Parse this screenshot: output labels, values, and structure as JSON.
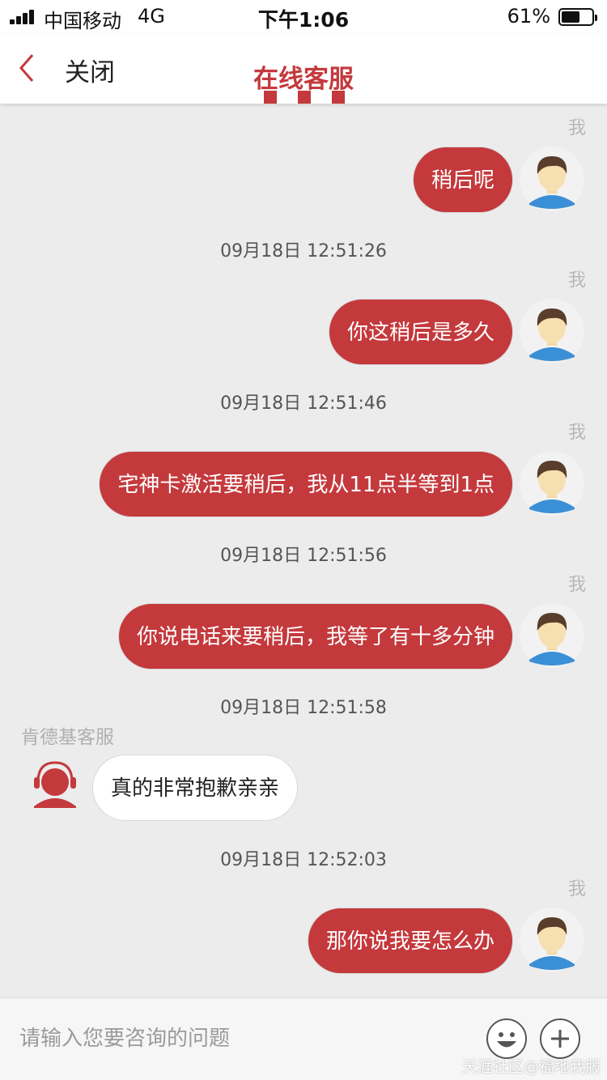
{
  "status_bar": {
    "carrier": "中国移动",
    "network": "4G",
    "time": "下午1:06",
    "battery_percent": "61%",
    "battery_level": 0.61
  },
  "nav": {
    "back_icon": "chevron-left-icon",
    "close_label": "关闭",
    "title": "在线客服"
  },
  "colors": {
    "accent": "#c4393c",
    "incoming_bubble": "#ffffff",
    "background": "#ececec"
  },
  "chat": {
    "self_tag": "我",
    "agent_name": "肯德基客服",
    "messages": [
      {
        "from": "me",
        "text": "稍后呢"
      },
      {
        "time": "09月18日 12:51:26"
      },
      {
        "from": "me",
        "text": "你这稍后是多久"
      },
      {
        "time": "09月18日 12:51:46"
      },
      {
        "from": "me",
        "text": "宅神卡激活要稍后，我从11点半等到1点"
      },
      {
        "time": "09月18日 12:51:56"
      },
      {
        "from": "me",
        "text": "你说电话来要稍后，我等了有十多分钟"
      },
      {
        "time": "09月18日 12:51:58"
      },
      {
        "from": "agent",
        "text": "真的非常抱歉亲亲"
      },
      {
        "time": "09月18日 12:52:03"
      },
      {
        "from": "me",
        "text": "那你说我要怎么办"
      }
    ]
  },
  "input": {
    "placeholder": "请输入您要咨询的问题",
    "value": "",
    "emoji_icon": "emoji-smile-icon",
    "plus_icon": "plus-circle-icon"
  },
  "watermark": "天涯社区@福地我服"
}
